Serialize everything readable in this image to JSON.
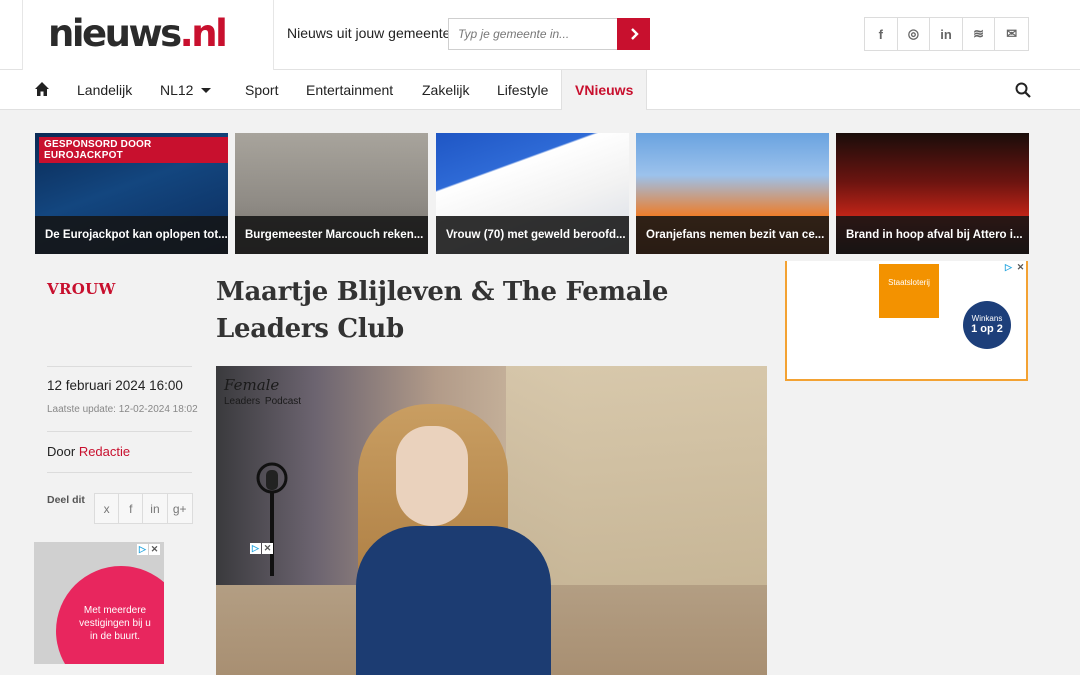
{
  "header": {
    "logo_main": "nieuws",
    "logo_tld": "nl",
    "gemeente_label": "Nieuws uit jouw gemeente:",
    "gemeente_placeholder": "Typ je gemeente in..."
  },
  "socials": [
    {
      "name": "facebook",
      "glyph": "f"
    },
    {
      "name": "instagram",
      "glyph": "◎"
    },
    {
      "name": "linkedin",
      "glyph": "in"
    },
    {
      "name": "rss",
      "glyph": "≋"
    },
    {
      "name": "mail",
      "glyph": "✉"
    }
  ],
  "nav": {
    "items": [
      "Landelijk",
      "NL12",
      "Sport",
      "Entertainment",
      "Zakelijk",
      "Lifestyle",
      "VNieuws"
    ],
    "active": "VNieuws"
  },
  "teasers": [
    {
      "badge": "GESPONSORD DOOR EUROJACKPOT",
      "caption": "De Eurojackpot kan oplopen tot..."
    },
    {
      "caption": "Burgemeester Marcouch reken..."
    },
    {
      "caption": "Vrouw (70) met geweld beroofd..."
    },
    {
      "caption": "Oranjefans nemen bezit van ce..."
    },
    {
      "caption": "Brand in hoop afval bij Attero i..."
    }
  ],
  "article": {
    "category": "VROUW",
    "title": "Maartje Blijleven & The Female Leaders Club",
    "date": "12 februari 2024 16:00",
    "updated": "Laatste update: 12-02-2024 18:02",
    "author_prefix": "Door",
    "author": "Redactie",
    "share_label": "Deel dit",
    "share_glyphs": [
      "x",
      "f",
      "in",
      "g+"
    ],
    "hero_overlay_line1": "Female",
    "hero_overlay_line2": "Leaders",
    "hero_overlay_line3": "Podcast"
  },
  "ads": {
    "left_text": "Met meerdere vestigingen bij u in de buurt.",
    "right_brand": "Staatsloterij",
    "right_winkans": "Winkans",
    "right_odds": "1 op 2"
  },
  "colors": {
    "accent": "#c8102e",
    "nav_active_bg": "#f2f2f2"
  }
}
